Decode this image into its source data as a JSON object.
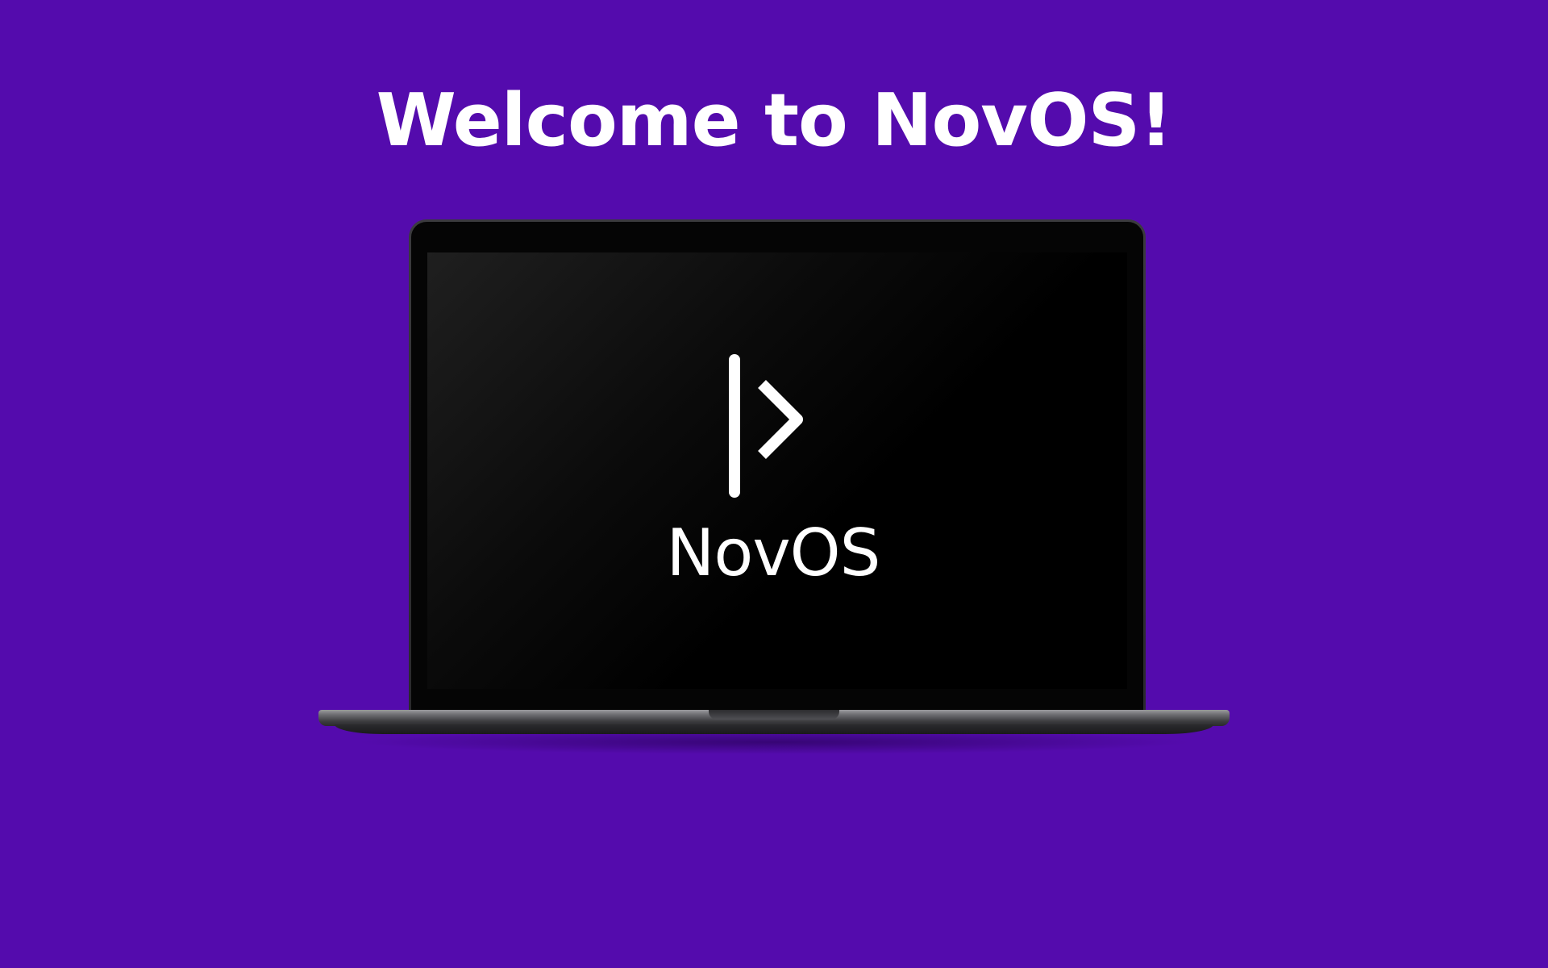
{
  "welcome": {
    "title": "Welcome to NovOS!"
  },
  "screen": {
    "logo_icon": "novos-logo-icon",
    "wordmark": "NovOS"
  },
  "colors": {
    "background": "#540bad",
    "screen": "#000000",
    "text": "#ffffff"
  }
}
